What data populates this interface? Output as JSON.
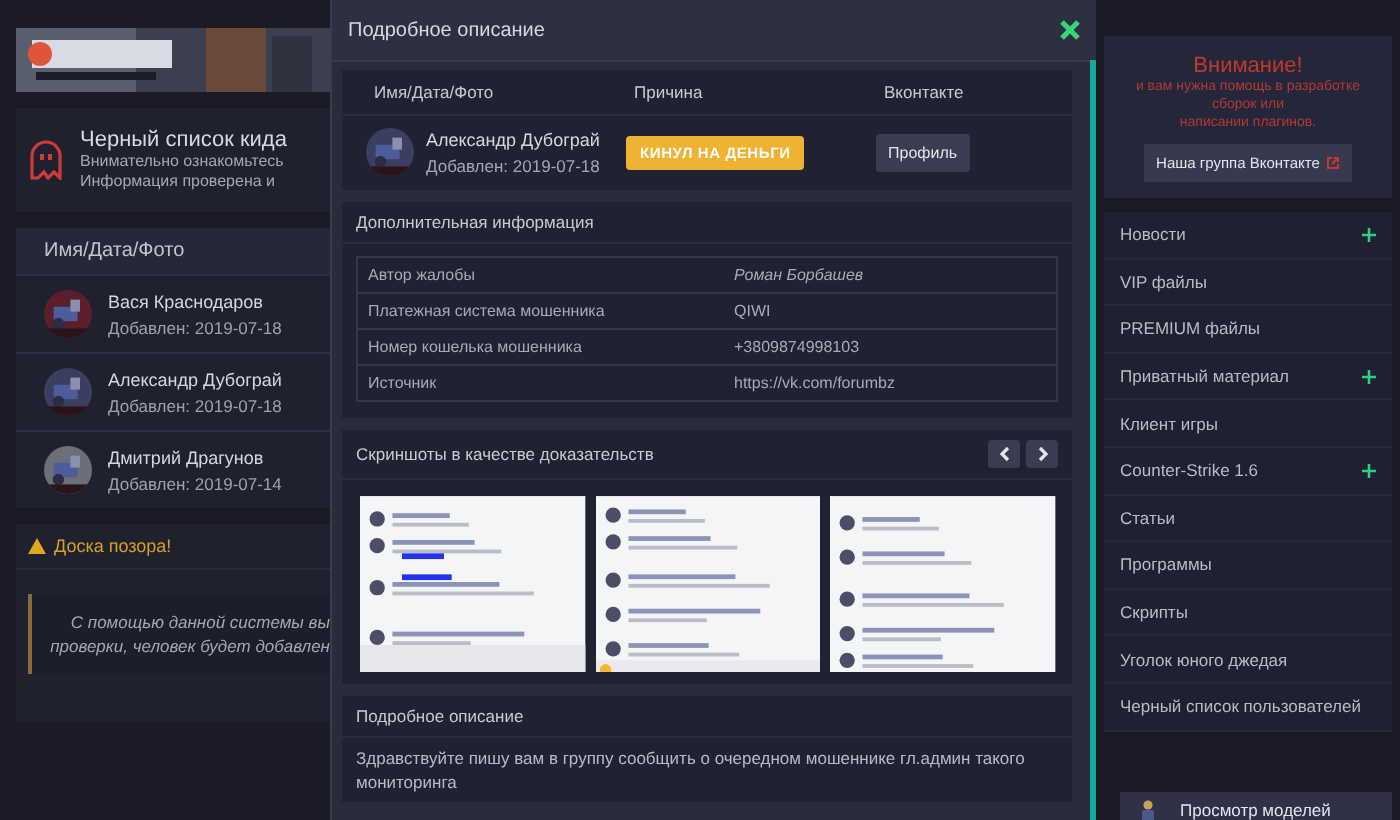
{
  "left": {
    "info_card": {
      "title": "Черный список кида",
      "lines": [
        "Внимательно ознакомьтесь",
        "Информация проверена и"
      ]
    },
    "table": {
      "header": "Имя/Дата/Фото",
      "rows": [
        {
          "name": "Вася Краснодаров",
          "date": "Добавлен: 2019-07-18"
        },
        {
          "name": "Александр Дубограй",
          "date": "Добавлен: 2019-07-18"
        },
        {
          "name": "Дмитрий Драгунов",
          "date": "Добавлен: 2019-07-14"
        }
      ]
    },
    "notice": {
      "title": "Доска позора!",
      "lines": [
        "С помощью данной системы вы",
        "проверки, человек будет добавлен"
      ]
    }
  },
  "modal": {
    "title": "Подробное описание",
    "columns": [
      "Имя/Дата/Фото",
      "Причина",
      "Вконтакте"
    ],
    "entry": {
      "name": "Александр Дубограй",
      "date": "Добавлен: 2019-07-18",
      "reason": "КИНУЛ НА ДЕНЬГИ",
      "profile_button": "Профиль"
    },
    "extra": {
      "title": "Дополнительная информация",
      "rows": [
        {
          "label": "Автор жалобы",
          "value": "Роман Борбашев"
        },
        {
          "label": "Платежная система мошенника",
          "value": "QIWI"
        },
        {
          "label": "Номер кошелька мошенника",
          "value": "+3809874998103"
        },
        {
          "label": "Источник",
          "value": "https://vk.com/forumbz"
        }
      ]
    },
    "screenshots": {
      "title": "Скриншоты в качестве доказательств"
    },
    "description": {
      "title": "Подробное описание",
      "text": "Здравствуйте пишу вам в группу сообщить о очередном мошеннике гл.админ такого мониторинга"
    }
  },
  "sidebar": {
    "alert": {
      "title": "Внимание!",
      "lines": [
        "и вам нужна помощь в разработке сборок или",
        "написании плагинов."
      ],
      "button": "Наша группа Вконтакте"
    },
    "items": [
      {
        "label": "Новости",
        "expandable": true
      },
      {
        "label": "VIP файлы",
        "expandable": false
      },
      {
        "label": "PREMIUM файлы",
        "expandable": false
      },
      {
        "label": "Приватный материал",
        "expandable": true
      },
      {
        "label": "Клиент игры",
        "expandable": false
      },
      {
        "label": "Counter-Strike 1.6",
        "expandable": true
      },
      {
        "label": "Статьи",
        "expandable": false
      },
      {
        "label": "Программы",
        "expandable": false
      },
      {
        "label": "Скрипты",
        "expandable": false
      },
      {
        "label": "Уголок юного джедая",
        "expandable": false
      },
      {
        "label": "Черный список пользователей",
        "expandable": false
      }
    ],
    "models_button": "Просмотр моделей"
  }
}
